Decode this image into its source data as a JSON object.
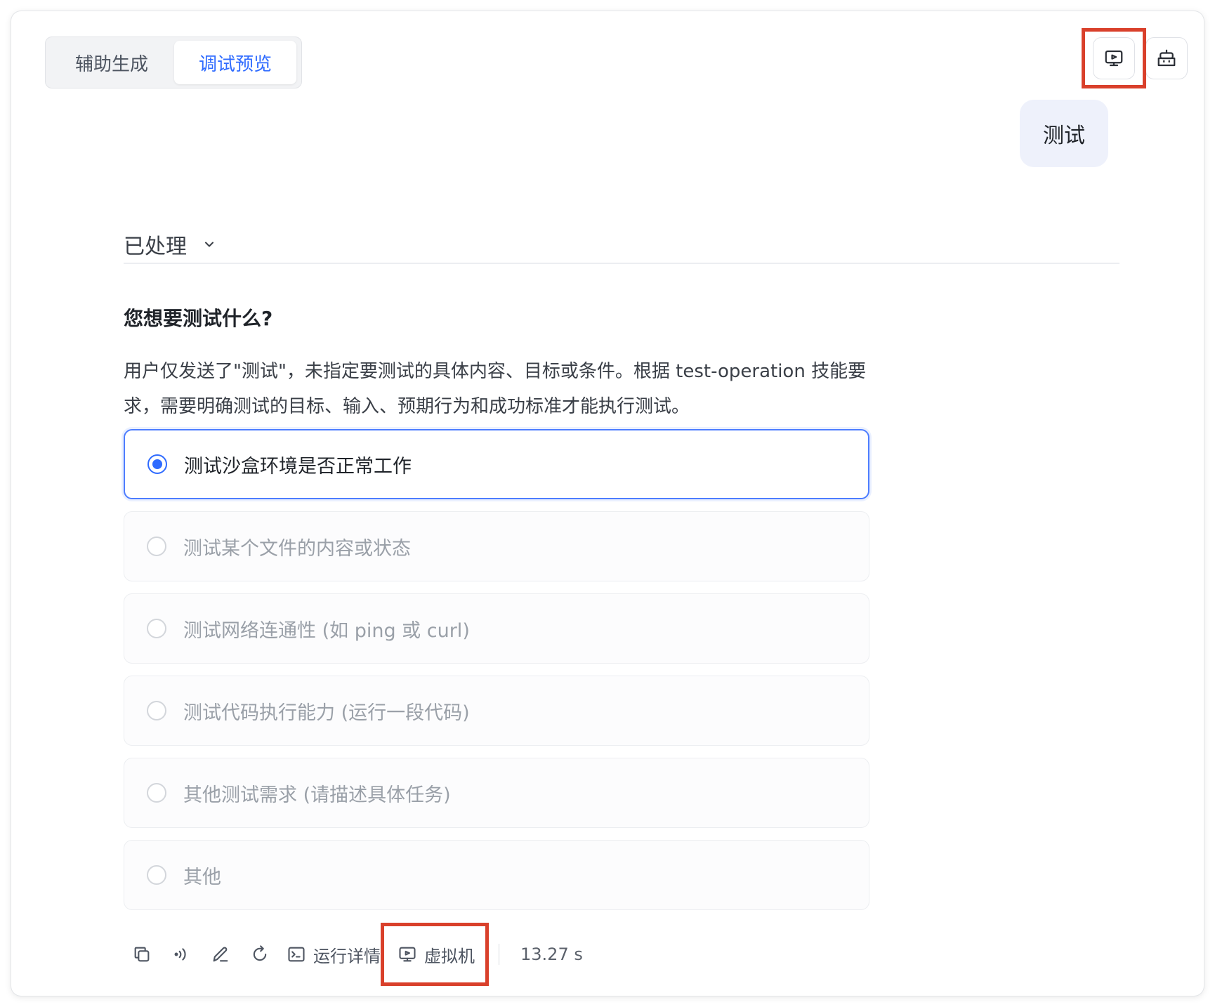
{
  "tabs": [
    {
      "label": "辅助生成",
      "active": false
    },
    {
      "label": "调试预览",
      "active": true
    }
  ],
  "header_icons": [
    "monitor-play-icon",
    "robot-icon"
  ],
  "user_message": "测试",
  "processed": {
    "label": "已处理"
  },
  "question": {
    "title": "您想要测试什么?",
    "description": "用户仅发送了\"测试\"，未指定要测试的具体内容、目标或条件。根据 test-operation 技能要求，需要明确测试的目标、输入、预期行为和成功标准才能执行测试。",
    "options": [
      {
        "label": "测试沙盒环境是否正常工作",
        "selected": true
      },
      {
        "label": "测试某个文件的内容或状态",
        "selected": false
      },
      {
        "label": "测试网络连通性 (如 ping 或 curl)",
        "selected": false
      },
      {
        "label": "测试代码执行能力 (运行一段代码)",
        "selected": false
      },
      {
        "label": "其他测试需求 (请描述具体任务)",
        "selected": false
      },
      {
        "label": "其他",
        "selected": false
      }
    ]
  },
  "toolbar": {
    "icons": [
      "copy-icon",
      "speaker-icon",
      "edit-icon",
      "retry-icon"
    ],
    "run_details_label": "运行详情",
    "vm_label": "虚拟机",
    "elapsed": "13.27 s"
  },
  "colors": {
    "accent": "#2f6bff",
    "highlight": "#d9402b",
    "bubble": "#eef1fb"
  }
}
